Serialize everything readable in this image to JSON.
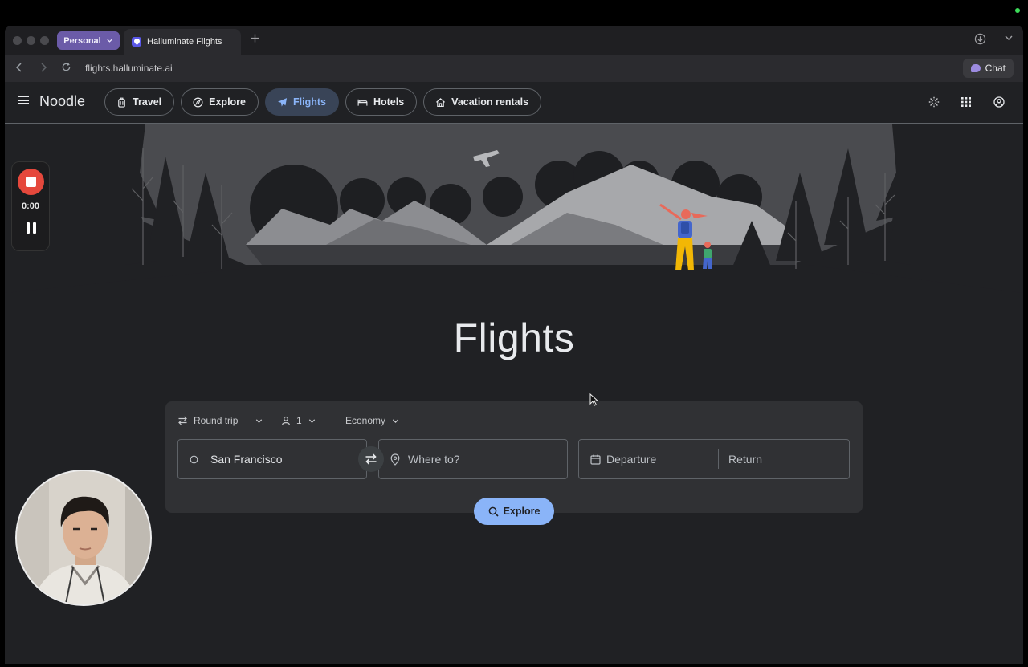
{
  "browser": {
    "profile_label": "Personal",
    "tab_title": "Halluminate Flights",
    "url": "flights.halluminate.ai",
    "chat_label": "Chat"
  },
  "app": {
    "brand": "Noodle",
    "nav_chips": [
      {
        "label": "Travel",
        "icon": "luggage-icon"
      },
      {
        "label": "Explore",
        "icon": "compass-icon"
      },
      {
        "label": "Flights",
        "icon": "airplane-icon",
        "active": true
      },
      {
        "label": "Hotels",
        "icon": "bed-icon"
      },
      {
        "label": "Vacation rentals",
        "icon": "home-icon"
      }
    ],
    "right_icons": [
      "theme-icon",
      "apps-grid-icon",
      "account-icon"
    ]
  },
  "hero": {
    "title": "Flights"
  },
  "search": {
    "trip_type": "Round trip",
    "passengers": "1",
    "cabin_class": "Economy",
    "origin_value": "San Francisco",
    "destination_placeholder": "Where to?",
    "departure_placeholder": "Departure",
    "return_placeholder": "Return",
    "explore_label": "Explore"
  },
  "recorder": {
    "time": "0:00"
  },
  "colors": {
    "accent": "#8ab4f8",
    "active_chip_bg": "#394457",
    "page_bg": "#202124",
    "card_bg": "#303134",
    "record_red": "#e5483c"
  }
}
